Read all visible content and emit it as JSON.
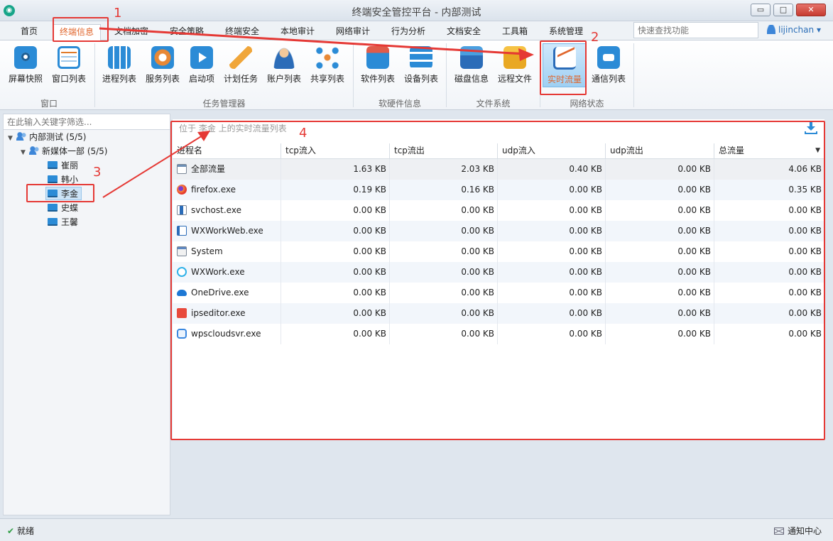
{
  "window": {
    "title": "终端安全管控平台 - 内部测试",
    "minimize": "▭",
    "maximize": "□",
    "close": "✕"
  },
  "menu": {
    "tabs": [
      "首页",
      "终端信息",
      "文档加密",
      "安全策略",
      "终端安全",
      "本地审计",
      "网络审计",
      "行为分析",
      "文档安全",
      "工具箱",
      "系统管理"
    ],
    "active_tab": "终端信息",
    "search_placeholder": "快速查找功能",
    "user": "lijinchan"
  },
  "ribbon": {
    "buttons": [
      "屏幕快照",
      "窗口列表",
      "进程列表",
      "服务列表",
      "启动项",
      "计划任务",
      "账户列表",
      "共享列表",
      "软件列表",
      "设备列表",
      "磁盘信息",
      "远程文件",
      "实时流量",
      "通信列表"
    ],
    "selected": "实时流量",
    "groups": [
      "窗口",
      "任务管理器",
      "软硬件信息",
      "文件系统",
      "网络状态"
    ]
  },
  "tree": {
    "filter_placeholder": "在此输入关键字筛选...",
    "root": "内部测试 (5/5)",
    "dept": "新媒体一部 (5/5)",
    "computers": [
      "崔丽",
      "韩小",
      "李金",
      "史蝶",
      "王馨"
    ],
    "selected": "李金"
  },
  "traffic": {
    "caption": "位于 李金 上的实时流量列表",
    "columns": [
      "进程名",
      "tcp流入",
      "tcp流出",
      "udp流入",
      "udp流出",
      "总流量"
    ],
    "rows": [
      {
        "name": "全部流量",
        "icon": "all-traffic-icon",
        "tcp_in": "1.63 KB",
        "tcp_out": "2.03 KB",
        "udp_in": "0.40 KB",
        "udp_out": "0.00 KB",
        "total": "4.06 KB"
      },
      {
        "name": "firefox.exe",
        "icon": "firefox-icon",
        "tcp_in": "0.19 KB",
        "tcp_out": "0.16 KB",
        "udp_in": "0.00 KB",
        "udp_out": "0.00 KB",
        "total": "0.35 KB"
      },
      {
        "name": "svchost.exe",
        "icon": "svchost-icon",
        "tcp_in": "0.00 KB",
        "tcp_out": "0.00 KB",
        "udp_in": "0.00 KB",
        "udp_out": "0.00 KB",
        "total": "0.00 KB"
      },
      {
        "name": "WXWorkWeb.exe",
        "icon": "wxworkweb-icon",
        "tcp_in": "0.00 KB",
        "tcp_out": "0.00 KB",
        "udp_in": "0.00 KB",
        "udp_out": "0.00 KB",
        "total": "0.00 KB"
      },
      {
        "name": "System",
        "icon": "system-icon",
        "tcp_in": "0.00 KB",
        "tcp_out": "0.00 KB",
        "udp_in": "0.00 KB",
        "udp_out": "0.00 KB",
        "total": "0.00 KB"
      },
      {
        "name": "WXWork.exe",
        "icon": "wxwork-icon",
        "tcp_in": "0.00 KB",
        "tcp_out": "0.00 KB",
        "udp_in": "0.00 KB",
        "udp_out": "0.00 KB",
        "total": "0.00 KB"
      },
      {
        "name": "OneDrive.exe",
        "icon": "onedrive-icon",
        "tcp_in": "0.00 KB",
        "tcp_out": "0.00 KB",
        "udp_in": "0.00 KB",
        "udp_out": "0.00 KB",
        "total": "0.00 KB"
      },
      {
        "name": "ipseditor.exe",
        "icon": "ipseditor-icon",
        "tcp_in": "0.00 KB",
        "tcp_out": "0.00 KB",
        "udp_in": "0.00 KB",
        "udp_out": "0.00 KB",
        "total": "0.00 KB"
      },
      {
        "name": "wpscloudsvr.exe",
        "icon": "wpscloud-icon",
        "tcp_in": "0.00 KB",
        "tcp_out": "0.00 KB",
        "udp_in": "0.00 KB",
        "udp_out": "0.00 KB",
        "total": "0.00 KB"
      }
    ]
  },
  "status": {
    "text": "就绪",
    "notify": "通知中心"
  },
  "annotations": {
    "labels": [
      "1",
      "2",
      "3",
      "4"
    ],
    "color": "#e53935"
  }
}
